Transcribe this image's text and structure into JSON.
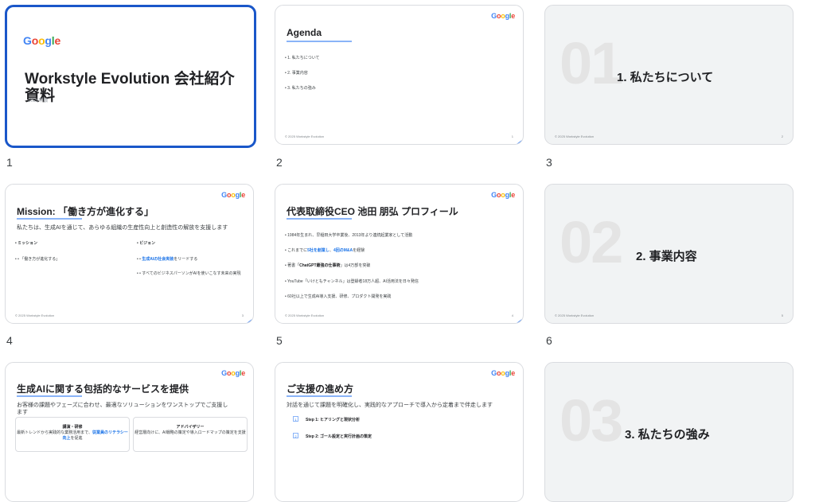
{
  "logo": {
    "g1": "G",
    "o1": "o",
    "o2": "o",
    "g2": "g",
    "l": "l",
    "e": "e"
  },
  "footer": "© 2025 Workstyle Evolution",
  "slides": [
    {
      "number": "1",
      "title": "Workstyle Evolution 会社紹介資料",
      "subtitle": "2025年版"
    },
    {
      "number": "2",
      "title": "Agenda",
      "page": "1",
      "bullets": [
        "• 1. 私たちについて",
        "• 2. 事業内容",
        "• 3. 私たちの強み"
      ]
    },
    {
      "number": "3",
      "bignum": "01",
      "title": "1. 私たちについて",
      "page": "2"
    },
    {
      "number": "4",
      "title": "Mission: 「働き方が進化する」",
      "page": "3",
      "intro": "私たちは、生成AIを通じて、あらゆる組織の生産性向上と創造性の解放を支援します",
      "left_head": "• ミッション",
      "left_item": "• • 「働き方が進化する」",
      "right_head": "• ビジョン",
      "right_item1_pre": "• • ",
      "right_item1_hl": "生成AIの社会実装",
      "right_item1_post": "をリードする",
      "right_item2": "• • すべてのビジネスパーソンがAIを使いこなす未来の実現"
    },
    {
      "number": "5",
      "title": "代表取締役CEO 池田 朋弘 プロフィール",
      "page": "4",
      "b1": "• 1984年生まれ、早稲田大学卒業後、2013年より連続起業家として活動",
      "b2_pre": "• これまでに",
      "b2_hl1": "5社を創業し",
      "b2_mid": "、",
      "b2_hl2": "4回のM&A",
      "b2_post": "を経験",
      "b3_pre": "• 著書「",
      "b3_b": "ChatGPT最強の仕事術",
      "b3_post": "」は4万部を突破",
      "b4": "• YouTube「いけともチャンネル」は登録者18万人超、AI活用法を日々発信",
      "b5": "• 60社以上で生成AI導入支援、研修、プロダクト開発を実践"
    },
    {
      "number": "6",
      "bignum": "02",
      "title": "2. 事業内容",
      "page": "5"
    },
    {
      "number": "7",
      "title": "生成AIに関する包括的なサービスを提供",
      "intro": "お客様の課題やフェーズに合わせ、最適なソリューションをワンストップでご支援します",
      "card1_title": "講演・研修",
      "card1_text": "最新トレンドから実践的な業務活用まで、",
      "card1_hl": "従業員のリテラシー向上",
      "card1_post": "を促進",
      "card2_title": "アドバイザリー",
      "card2_text": "経営層向けに、AI戦略の策定や導入ロードマップの策定を支援"
    },
    {
      "number": "8",
      "title": "ご支援の進め方",
      "intro": "対話を通じて課題を明確化し、実践的なアプローチで導入から定着まで伴走します",
      "step1_no": "1",
      "step1": "Step 1: ヒアリングと現状分析",
      "step2_no": "2",
      "step2": "Step 2: ゴール設定と実行計画の策定"
    },
    {
      "number": "9",
      "bignum": "03",
      "title": "3. 私たちの強み"
    }
  ]
}
